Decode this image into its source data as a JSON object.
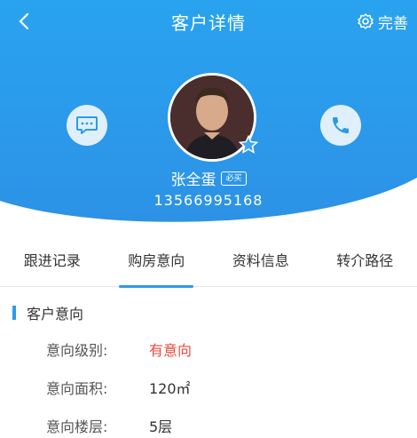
{
  "header": {
    "title": "客户详情",
    "perfect_label": "完善"
  },
  "customer": {
    "name": "张全蛋",
    "badge": "必买",
    "phone": "13566995168"
  },
  "tabs": [
    "跟进记录",
    "购房意向",
    "资料信息",
    "转介路径"
  ],
  "active_tab_index": 1,
  "section": {
    "title": "客户意向",
    "rows": [
      {
        "label": "意向级别:",
        "value": "有意向"
      },
      {
        "label": "意向面积:",
        "value": "120㎡"
      },
      {
        "label": "意向楼层:",
        "value": "5层"
      }
    ]
  },
  "colors": {
    "header_blue": "#2d9ae8",
    "accent_red": "#e64a3b"
  }
}
